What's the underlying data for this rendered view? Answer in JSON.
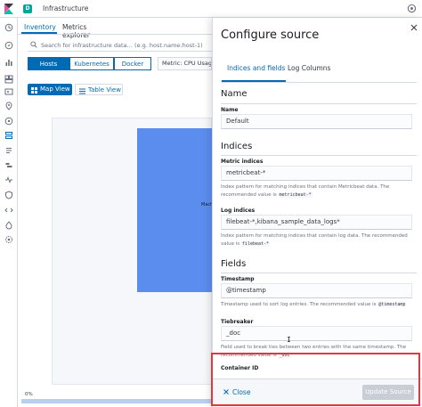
{
  "header": {
    "space_initial": "D",
    "app_title": "Infrastructure"
  },
  "tabs": {
    "inventory": "Inventory",
    "metrics_explorer": "Metrics explorer"
  },
  "search": {
    "placeholder": "Search for infrastructure data… (e.g. host.name:host-1)"
  },
  "node_types": {
    "hosts": "Hosts",
    "kubernetes": "Kubernetes",
    "docker": "Docker"
  },
  "metric_select": {
    "value": "Metric: CPU Usage"
  },
  "view_toggle": {
    "map_view": "Map View",
    "table_view": "Table View"
  },
  "map": {
    "tile_label": "Mach"
  },
  "progress": {
    "label": "0%",
    "value": 0
  },
  "flyout": {
    "title": "Configure source",
    "tabs": {
      "indices_and_fields": "Indices and fields",
      "log_columns": "Log Columns"
    },
    "sections": {
      "name_title": "Name",
      "name_label": "Name",
      "name_value": "Default",
      "indices_title": "Indices",
      "metric_indices_label": "Metric indices",
      "metric_indices_value": "metricbeat-*",
      "metric_indices_help": "Index pattern for matching indices that contain Metricbeat data. The recommended value is",
      "metric_indices_code": "metricbeat-*",
      "log_indices_label": "Log indices",
      "log_indices_value": "filebeat-*,kibana_sample_data_logs*",
      "log_indices_help": "Index pattern for matching indices that contain log data. The recommended value is",
      "log_indices_code": "filebeat-*",
      "fields_title": "Fields",
      "timestamp_label": "Timestamp",
      "timestamp_value": "@timestamp",
      "timestamp_help": "Timestamp used to sort log entries. The recommended value is",
      "timestamp_code": "@timestamp",
      "tiebreaker_label": "Tiebreaker",
      "tiebreaker_value": "_doc",
      "tiebreaker_help": "Field used to break ties between two entries with the same timestamp. The recommended value is",
      "tiebreaker_code": "_doc",
      "container_id_label": "Container ID"
    },
    "footer": {
      "close": "Close",
      "update": "Update Source"
    }
  },
  "colors": {
    "accent": "#006bb4",
    "highlight": "#e0383e",
    "map_tile": "#5b8def",
    "space_badge": "#00a69b"
  }
}
